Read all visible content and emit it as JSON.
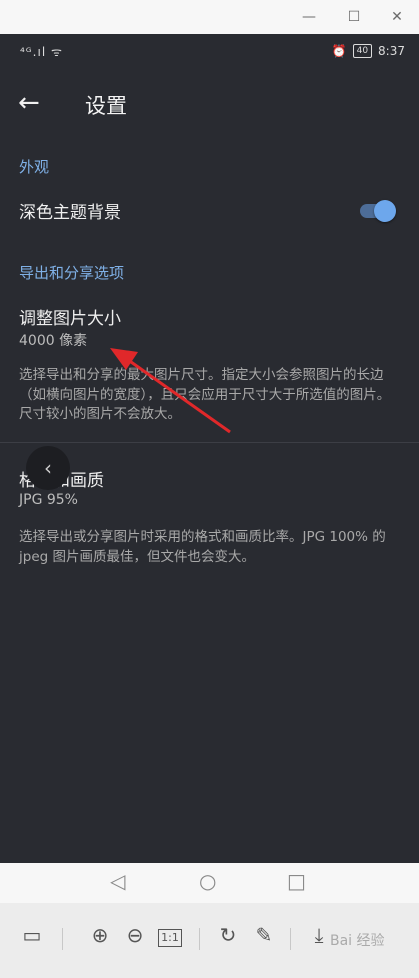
{
  "window_controls": {
    "minimize": "—",
    "maximize": "☐",
    "close": "✕"
  },
  "status_bar": {
    "signal": "⁴ᴳ.ıl ᯤ",
    "alarm": "⏰",
    "battery": "40",
    "time": "8:37"
  },
  "app_bar": {
    "back_icon": "←",
    "title": "设置"
  },
  "sections": {
    "appearance": {
      "header": "外观",
      "dark_theme": {
        "label": "深色主题背景",
        "enabled": true
      }
    },
    "export": {
      "header": "导出和分享选项",
      "resize": {
        "title": "调整图片大小",
        "value": "4000 像素",
        "description": "选择导出和分享的最大图片尺寸。指定大小会参照图片的长边（如横向图片的宽度），且只会应用于尺寸大于所选值的图片。尺寸较小的图片不会放大。"
      },
      "format": {
        "title": "格式和画质",
        "value": "JPG 95%",
        "description": "选择导出或分享图片时采用的格式和画质比率。JPG 100% 的 jpeg 图片画质最佳，但文件也会变大。"
      }
    }
  },
  "floating_back": "‹",
  "nav_bar": {
    "back": "◁",
    "home": "○",
    "recents": "□"
  },
  "toolbar": {
    "layout": "▭",
    "zoom_in": "⊕",
    "zoom_out": "⊖",
    "actual_size": "1:1",
    "rotate": "↻",
    "edit": "✎",
    "download": "⤓"
  },
  "watermark": "Bai 经验",
  "colors": {
    "accent": "#6da7ec",
    "background": "#292b31",
    "annotation_arrow": "#e0282a"
  }
}
